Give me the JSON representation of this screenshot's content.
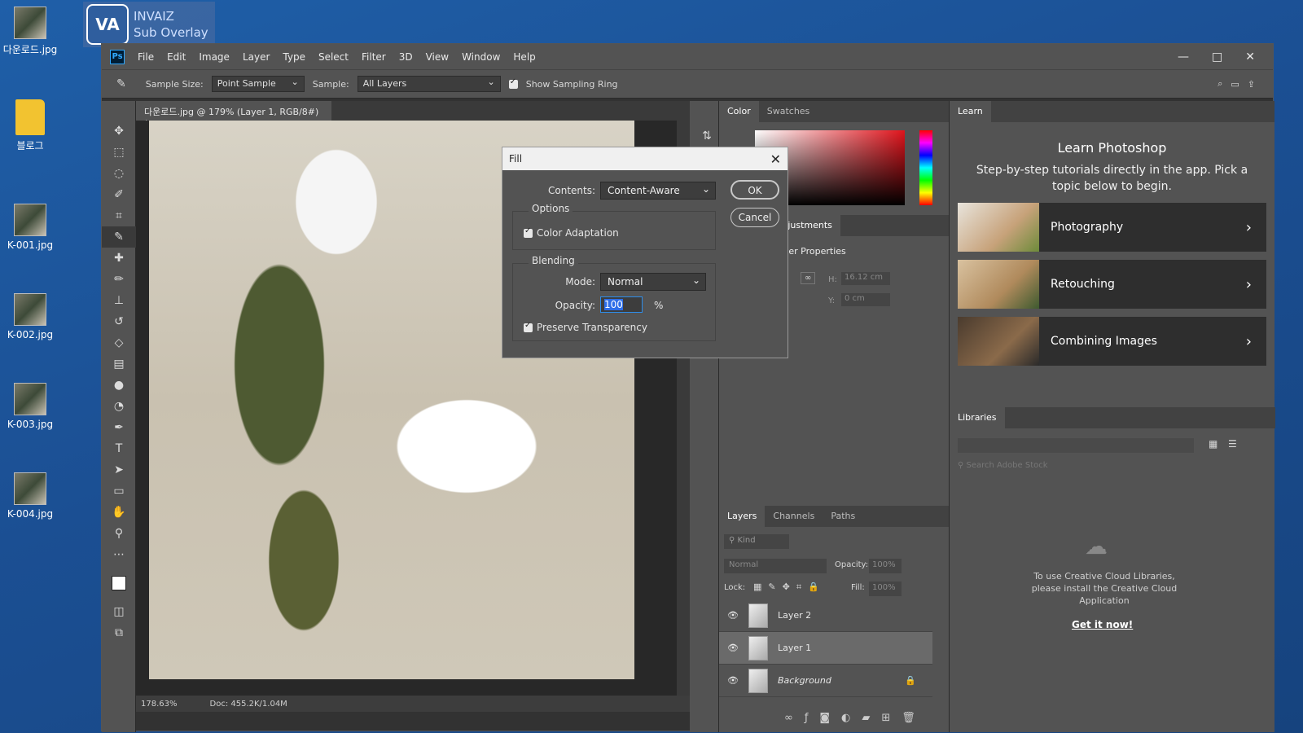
{
  "desktop": {
    "icons": [
      {
        "label": "다운로드.jpg",
        "type": "image"
      },
      {
        "label": "블로그",
        "type": "folder"
      },
      {
        "label": "K-001.jpg",
        "type": "image"
      },
      {
        "label": "K-002.jpg",
        "type": "image"
      },
      {
        "label": "K-003.jpg",
        "type": "image"
      },
      {
        "label": "K-004.jpg",
        "type": "image"
      }
    ],
    "overlay": {
      "logo": "VA",
      "line1": "INVAIZ",
      "line2": "Sub Overlay"
    }
  },
  "app": {
    "logo": "Ps",
    "menu": [
      "File",
      "Edit",
      "Image",
      "Layer",
      "Type",
      "Select",
      "Filter",
      "3D",
      "View",
      "Window",
      "Help"
    ],
    "window_controls": {
      "minimize": "—",
      "maximize": "□",
      "close": "✕"
    }
  },
  "options": {
    "sample_size_label": "Sample Size:",
    "sample_size_value": "Point Sample",
    "sample_label": "Sample:",
    "sample_value": "All Layers",
    "show_ring_label": "Show Sampling Ring"
  },
  "document": {
    "tab_title": "다운로드.jpg @ 179% (Layer 1, RGB/8#) *",
    "tab_close": "×",
    "zoom": "178.63%",
    "doc_size": "Doc: 455.2K/1.04M"
  },
  "color_panel": {
    "tabs": [
      "Color",
      "Swatches"
    ],
    "active": "Color"
  },
  "properties_panel": {
    "tabs": [
      "Adjustments"
    ],
    "title": "Layer Properties",
    "h_label": "H:",
    "h_value": "16.12 cm",
    "y_label": "Y:",
    "y_value": "0 cm"
  },
  "layers_panel": {
    "tabs": [
      "Layers",
      "Channels",
      "Paths"
    ],
    "active": "Layers",
    "filter_placeholder": "Kind",
    "blend_mode": "Normal",
    "opacity_label": "Opacity:",
    "opacity_value": "100%",
    "lock_label": "Lock:",
    "fill_label": "Fill:",
    "fill_value": "100%",
    "layers": [
      {
        "name": "Layer 2",
        "selected": false
      },
      {
        "name": "Layer 1",
        "selected": true
      },
      {
        "name": "Background",
        "selected": false
      }
    ]
  },
  "learn_panel": {
    "tab": "Learn",
    "title": "Learn Photoshop",
    "subtitle": "Step-by-step tutorials directly in the app. Pick a topic below to begin.",
    "cards": [
      "Photography",
      "Retouching",
      "Combining Images"
    ],
    "arrow": "›"
  },
  "libraries_panel": {
    "tab": "Libraries",
    "search_placeholder": "Search Adobe Stock",
    "message": "To use Creative Cloud Libraries, please install the Creative Cloud Application",
    "link": "Get it now!"
  },
  "fill_dialog": {
    "title": "Fill",
    "contents_label": "Contents:",
    "contents_value": "Content-Aware",
    "ok": "OK",
    "cancel": "Cancel",
    "options_title": "Options",
    "color_adaptation_label": "Color Adaptation",
    "blending_title": "Blending",
    "mode_label": "Mode:",
    "mode_value": "Normal",
    "opacity_label": "Opacity:",
    "opacity_value": "100",
    "opacity_unit": "%",
    "preserve_transparency_label": "Preserve Transparency"
  },
  "colors": {
    "ps_dark": "#323232",
    "ps_panel": "#535353",
    "accent": "#31a8ff",
    "desktop": "#1b4f93"
  }
}
